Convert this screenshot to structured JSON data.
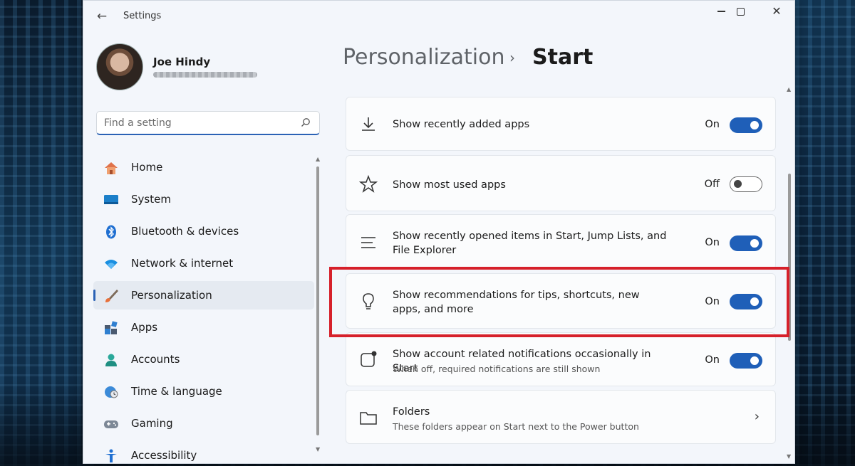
{
  "window": {
    "title": "Settings"
  },
  "profile": {
    "name": "Joe Hindy"
  },
  "search": {
    "placeholder": "Find a setting"
  },
  "nav": [
    {
      "label": "Home",
      "icon": "home-icon"
    },
    {
      "label": "System",
      "icon": "system-icon"
    },
    {
      "label": "Bluetooth & devices",
      "icon": "bluetooth-icon"
    },
    {
      "label": "Network & internet",
      "icon": "wifi-icon"
    },
    {
      "label": "Personalization",
      "icon": "brush-icon",
      "active": true
    },
    {
      "label": "Apps",
      "icon": "apps-icon"
    },
    {
      "label": "Accounts",
      "icon": "person-icon"
    },
    {
      "label": "Time & language",
      "icon": "globe-clock-icon"
    },
    {
      "label": "Gaming",
      "icon": "gamepad-icon"
    },
    {
      "label": "Accessibility",
      "icon": "accessibility-icon"
    }
  ],
  "breadcrumb": {
    "parent": "Personalization",
    "separator": "›",
    "current": "Start"
  },
  "settings": [
    {
      "title": "Show recently added apps",
      "state": "On",
      "on": true,
      "icon": "download-icon"
    },
    {
      "title": "Show most used apps",
      "state": "Off",
      "on": false,
      "icon": "star-icon"
    },
    {
      "title": "Show recently opened items in Start, Jump Lists, and File Explorer",
      "state": "On",
      "on": true,
      "icon": "list-icon"
    },
    {
      "title": "Show recommendations for tips, shortcuts, new apps, and more",
      "state": "On",
      "on": true,
      "icon": "lightbulb-icon"
    },
    {
      "title": "Show account related notifications occasionally in Start",
      "subtitle": "When off, required notifications are still shown",
      "state": "On",
      "on": true,
      "icon": "notification-icon"
    }
  ],
  "folders": {
    "title": "Folders",
    "subtitle": "These folders appear on Start next to the Power button",
    "icon": "folder-icon"
  },
  "colors": {
    "accent": "#1f5fb8",
    "highlight": "#d6202a",
    "window_bg": "#f3f6fb"
  }
}
